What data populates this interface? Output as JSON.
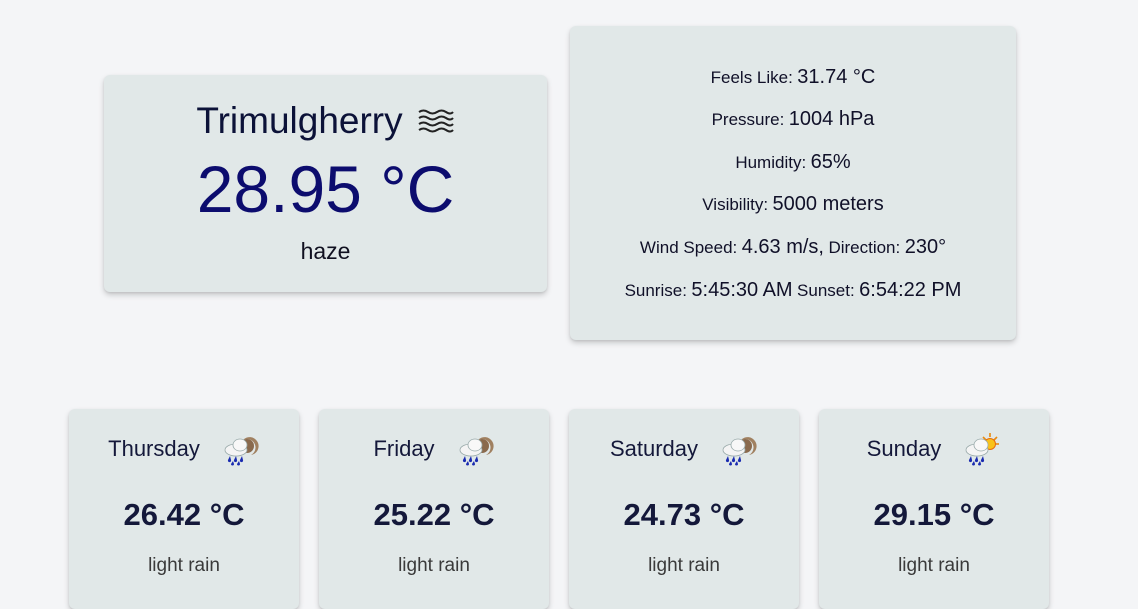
{
  "current": {
    "city": "Trimulgherry",
    "temperature": "28.95 °C",
    "description": "haze",
    "icon": "haze-icon"
  },
  "details": {
    "feels_like_label": "Feels Like:",
    "feels_like_value": "31.74 °C",
    "pressure_label": "Pressure:",
    "pressure_value": "1004 hPa",
    "humidity_label": "Humidity:",
    "humidity_value": "65%",
    "visibility_label": "Visibility:",
    "visibility_value": "5000 meters",
    "wind_speed_label": "Wind Speed:",
    "wind_speed_value": "4.63 m/s,",
    "direction_label": "Direction:",
    "direction_value": "230°",
    "sunrise_label": "Sunrise:",
    "sunrise_value": "5:45:30 AM",
    "sunset_label": "Sunset:",
    "sunset_value": "6:54:22 PM"
  },
  "forecast": [
    {
      "day": "Thursday",
      "temperature": "26.42 °C",
      "description": "light rain",
      "icon": "rain-night-icon"
    },
    {
      "day": "Friday",
      "temperature": "25.22 °C",
      "description": "light rain",
      "icon": "rain-night-icon"
    },
    {
      "day": "Saturday",
      "temperature": "24.73 °C",
      "description": "light rain",
      "icon": "rain-night-icon"
    },
    {
      "day": "Sunday",
      "temperature": "29.15 °C",
      "description": "light rain",
      "icon": "rain-day-icon"
    }
  ],
  "colors": {
    "background": "#f4f5f7",
    "card": "#e1e8e8",
    "temperature": "#0c0c6e",
    "rain_drop": "#1a2bb0"
  }
}
